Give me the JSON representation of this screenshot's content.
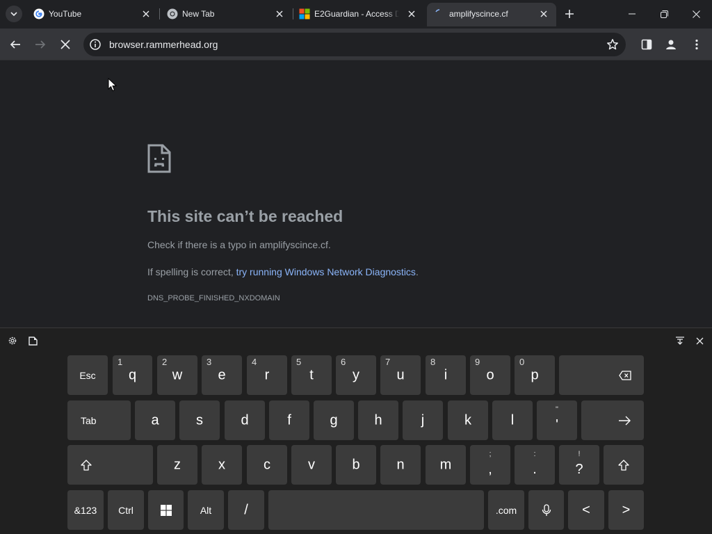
{
  "tabs": [
    {
      "title": "YouTube",
      "favicon": "google-g-icon"
    },
    {
      "title": "New Tab",
      "favicon": "chrome-icon"
    },
    {
      "title": "E2Guardian - Access D",
      "favicon": "microsoft-icon"
    },
    {
      "title": "amplifyscince.cf",
      "favicon": "loading-icon",
      "active": true
    }
  ],
  "toolbar": {
    "url": "browser.rammerhead.org"
  },
  "error": {
    "title": "This site can’t be reached",
    "line1": "Check if there is a typo in amplifyscince.cf.",
    "line2_prefix": "If spelling is correct, ",
    "line2_link": "try running Windows Network Diagnostics",
    "line2_suffix": ".",
    "code": "DNS_PROBE_FINISHED_NXDOMAIN"
  },
  "keyboard": {
    "row1": [
      {
        "label": "Esc"
      },
      {
        "label": "q",
        "sub": "1"
      },
      {
        "label": "w",
        "sub": "2"
      },
      {
        "label": "e",
        "sub": "3"
      },
      {
        "label": "r",
        "sub": "4"
      },
      {
        "label": "t",
        "sub": "5"
      },
      {
        "label": "y",
        "sub": "6"
      },
      {
        "label": "u",
        "sub": "7"
      },
      {
        "label": "i",
        "sub": "8"
      },
      {
        "label": "o",
        "sub": "9"
      },
      {
        "label": "p",
        "sub": "0"
      },
      {
        "label": "backspace-icon"
      }
    ],
    "row2": [
      {
        "label": "Tab"
      },
      {
        "label": "a"
      },
      {
        "label": "s"
      },
      {
        "label": "d"
      },
      {
        "label": "f"
      },
      {
        "label": "g"
      },
      {
        "label": "h"
      },
      {
        "label": "j"
      },
      {
        "label": "k"
      },
      {
        "label": "l"
      },
      {
        "label": "'",
        "sub": "\""
      },
      {
        "label": "enter-arrow-icon"
      }
    ],
    "row3": [
      {
        "label": "shift-icon"
      },
      {
        "label": "z"
      },
      {
        "label": "x"
      },
      {
        "label": "c"
      },
      {
        "label": "v"
      },
      {
        "label": "b"
      },
      {
        "label": "n"
      },
      {
        "label": "m"
      },
      {
        "label": ",",
        "sub": ";"
      },
      {
        "label": ".",
        "sub": ":"
      },
      {
        "label": "?",
        "sub": "!"
      },
      {
        "label": "shift-icon"
      }
    ],
    "row4": [
      {
        "label": "&123"
      },
      {
        "label": "Ctrl"
      },
      {
        "label": "windows-icon"
      },
      {
        "label": "Alt"
      },
      {
        "label": "/"
      },
      {
        "label": ""
      },
      {
        "label": ".com"
      },
      {
        "label": "microphone-icon"
      },
      {
        "label": "<"
      },
      {
        "label": ">"
      }
    ]
  },
  "colors": {
    "accent_link": "#8ab4f8",
    "page_bg": "#202124",
    "key_bg": "#3b3b3b"
  }
}
